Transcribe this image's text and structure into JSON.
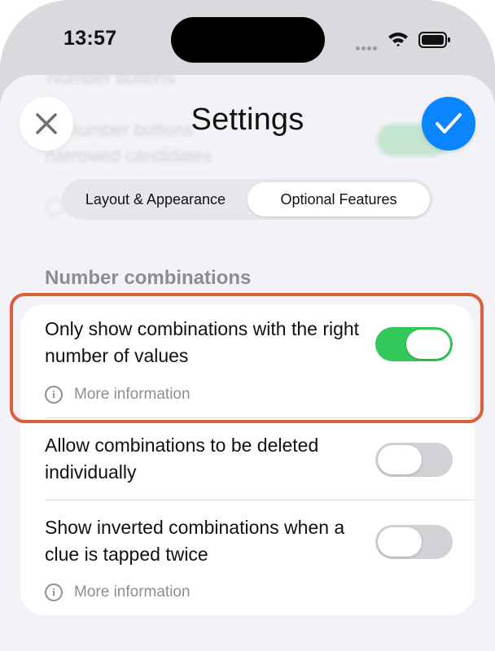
{
  "status_bar": {
    "time": "13:57"
  },
  "ghost": {
    "line1": "Number buttons",
    "line2": "number buttons",
    "line3": "narrowed candidates"
  },
  "header": {
    "title": "Settings"
  },
  "tabs": [
    {
      "label": "Layout & Appearance",
      "selected": false
    },
    {
      "label": "Optional Features",
      "selected": true
    }
  ],
  "section": {
    "title": "Number combinations",
    "rows": [
      {
        "label": "Only show combinations with the right number of values",
        "enabled": true,
        "info": "More information"
      },
      {
        "label": "Allow combinations to be deleted individually",
        "enabled": false
      },
      {
        "label": "Show inverted combinations when a clue is tapped twice",
        "enabled": false,
        "info": "More information"
      }
    ]
  },
  "colors": {
    "accent": "#0a84ff",
    "toggle_on": "#34c759",
    "toggle_off": "#d1d1d6",
    "highlight": "#e05d3c"
  }
}
